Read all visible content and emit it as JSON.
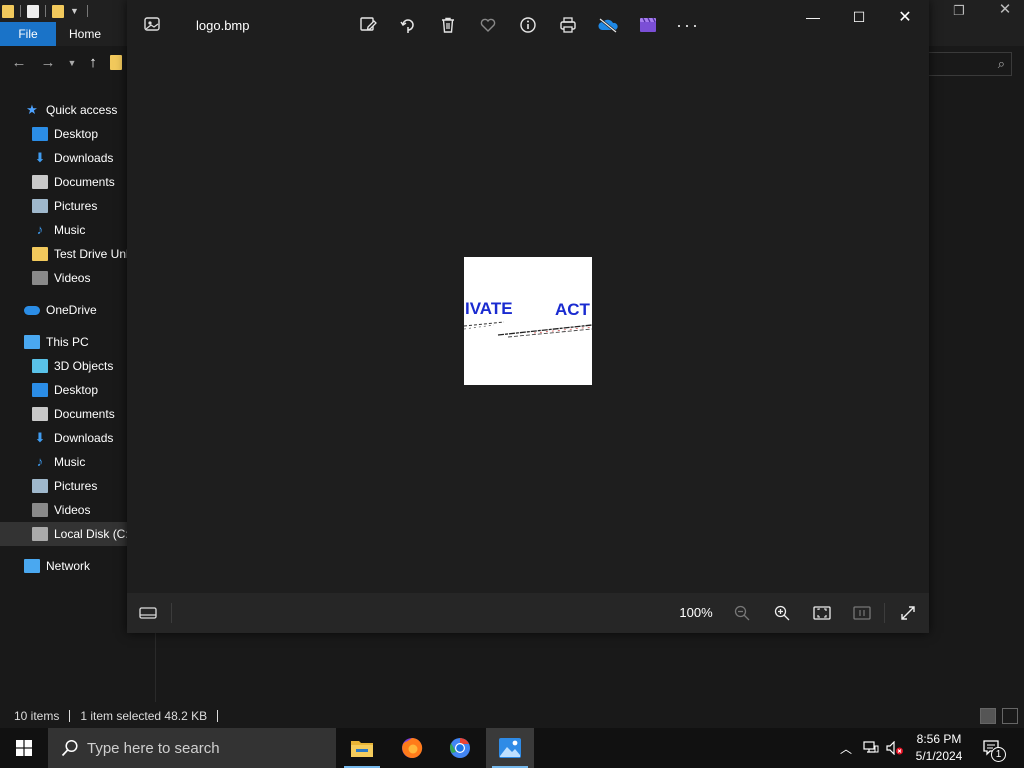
{
  "explorer": {
    "ribbon_tabs": [
      "File",
      "Home"
    ],
    "nav_items": [
      {
        "label": "Quick access",
        "icon": "star-icon",
        "level": 0
      },
      {
        "label": "Desktop",
        "icon": "desktop-folder-icon",
        "level": 1
      },
      {
        "label": "Downloads",
        "icon": "download-arrow-icon",
        "level": 1
      },
      {
        "label": "Documents",
        "icon": "documents-icon",
        "level": 1
      },
      {
        "label": "Pictures",
        "icon": "pictures-icon",
        "level": 1
      },
      {
        "label": "Music",
        "icon": "music-note-icon",
        "level": 1
      },
      {
        "label": "Test Drive Unli",
        "icon": "folder-icon",
        "level": 1
      },
      {
        "label": "Videos",
        "icon": "videos-icon",
        "level": 1
      },
      {
        "label": "OneDrive",
        "icon": "cloud-icon",
        "level": 0
      },
      {
        "label": "This PC",
        "icon": "computer-icon",
        "level": 0
      },
      {
        "label": "3D Objects",
        "icon": "cube-icon",
        "level": 1
      },
      {
        "label": "Desktop",
        "icon": "desktop-folder-icon",
        "level": 1
      },
      {
        "label": "Documents",
        "icon": "documents-icon",
        "level": 1
      },
      {
        "label": "Downloads",
        "icon": "download-arrow-icon",
        "level": 1
      },
      {
        "label": "Music",
        "icon": "music-note-icon",
        "level": 1
      },
      {
        "label": "Pictures",
        "icon": "pictures-icon",
        "level": 1
      },
      {
        "label": "Videos",
        "icon": "videos-icon",
        "level": 1
      },
      {
        "label": "Local Disk (C:)",
        "icon": "drive-icon",
        "level": 1,
        "selected": true
      },
      {
        "label": "Network",
        "icon": "network-icon",
        "level": 0
      }
    ],
    "status": {
      "item_count": "10 items",
      "selection": "1 item selected  48.2 KB"
    }
  },
  "photos": {
    "filename": "logo.bmp",
    "image_text": {
      "left": "IVATE",
      "right": "ACT"
    },
    "toolbar_icons": [
      "edit-image-icon",
      "rotate-icon",
      "delete-icon",
      "favorite-heart-icon",
      "info-icon",
      "print-icon",
      "onedrive-offline-icon",
      "video-editor-icon",
      "more-options-icon"
    ],
    "zoom": "100%"
  },
  "taskbar": {
    "search_placeholder": "Type here to search",
    "time": "8:56 PM",
    "date": "5/1/2024",
    "notification_count": "1"
  },
  "colors": {
    "accent_blue": "#1a73c8",
    "folder_yellow": "#f2c95c",
    "logo_blue": "#1a2bd0"
  }
}
